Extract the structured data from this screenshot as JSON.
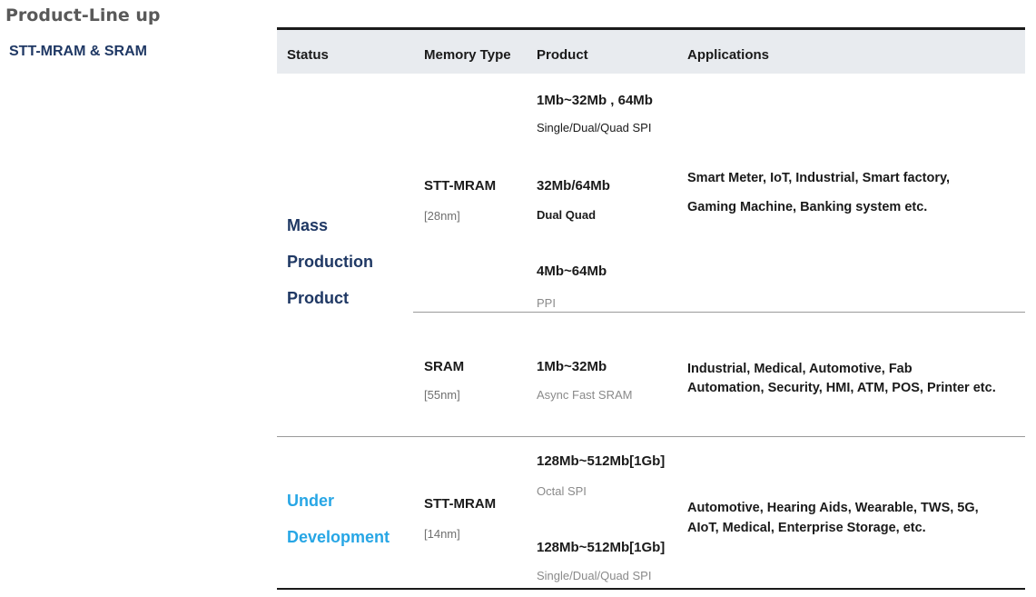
{
  "page": {
    "title": "Product-Line up",
    "subtitle": "STT-MRAM & SRAM"
  },
  "table": {
    "headers": [
      "Status",
      "Memory Type",
      "Product",
      "Applications"
    ],
    "groups": [
      {
        "status_lines": [
          "Mass",
          "Production",
          "Product"
        ],
        "memories": [
          {
            "type": "STT-MRAM",
            "node": "[28nm]",
            "products": [
              {
                "name": "1Mb~32Mb , 64Mb",
                "sub": "Single/Dual/Quad SPI"
              },
              {
                "name": "32Mb/64Mb",
                "sub": "Dual Quad"
              },
              {
                "name": "4Mb~64Mb",
                "sub": "PPI"
              }
            ],
            "applications": [
              "Smart Meter, IoT, Industrial, Smart factory,",
              "Gaming Machine, Banking system etc."
            ]
          },
          {
            "type": "SRAM",
            "node": "[55nm]",
            "products": [
              {
                "name": "1Mb~32Mb",
                "sub": "Async Fast SRAM"
              }
            ],
            "applications": [
              "Industrial, Medical, Automotive, Fab",
              "Automation, Security, HMI, ATM, POS, Printer etc."
            ]
          }
        ]
      },
      {
        "status_lines": [
          "Under",
          "Development"
        ],
        "memories": [
          {
            "type": "STT-MRAM",
            "node": "[14nm]",
            "products": [
              {
                "name": "128Mb~512Mb[1Gb]",
                "sub": "Octal SPI"
              },
              {
                "name": "128Mb~512Mb[1Gb]",
                "sub": "Single/Dual/Quad SPI"
              }
            ],
            "applications": [
              "Automotive, Hearing Aids, Wearable, TWS, 5G,",
              "AIoT, Medical, Enterprise Storage, etc."
            ]
          }
        ]
      }
    ]
  },
  "colors": {
    "status_mass": "#1f3864",
    "status_dev": "#27a6e5",
    "header_bg": "#e8ebef",
    "title_gray": "#595959"
  }
}
